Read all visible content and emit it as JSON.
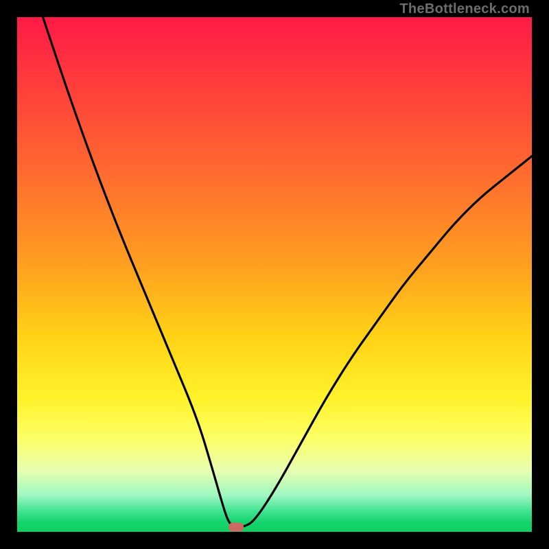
{
  "watermark": "TheBottleneck.com",
  "chart_data": {
    "type": "line",
    "title": "",
    "xlabel": "",
    "ylabel": "",
    "xlim": [
      0,
      100
    ],
    "ylim": [
      0,
      100
    ],
    "background_gradient": {
      "top_color": "#ff1a46",
      "mid_color": "#fff22a",
      "bottom_color": "#0fd060",
      "meaning": "red/orange high values → green low values (bottleneck severity scale)"
    },
    "series": [
      {
        "name": "bottleneck-curve",
        "x": [
          5,
          10,
          15,
          20,
          25,
          30,
          35,
          38,
          40,
          41,
          42,
          43,
          44,
          46,
          50,
          55,
          60,
          65,
          70,
          75,
          80,
          85,
          90,
          95,
          100
        ],
        "y": [
          100,
          85,
          71,
          58,
          46,
          34,
          22,
          12,
          5,
          2,
          1,
          1,
          1,
          2,
          8,
          17,
          26,
          34,
          41,
          48,
          54,
          60,
          65,
          69,
          73
        ]
      }
    ],
    "marker": {
      "name": "optimal-point",
      "x": 42.5,
      "y": 1,
      "color": "#cb6a63",
      "shape": "rounded-rect"
    }
  },
  "colors": {
    "frame": "#000000",
    "curve": "#000000",
    "marker": "#cb6a63",
    "watermark": "#6d6d6d"
  }
}
